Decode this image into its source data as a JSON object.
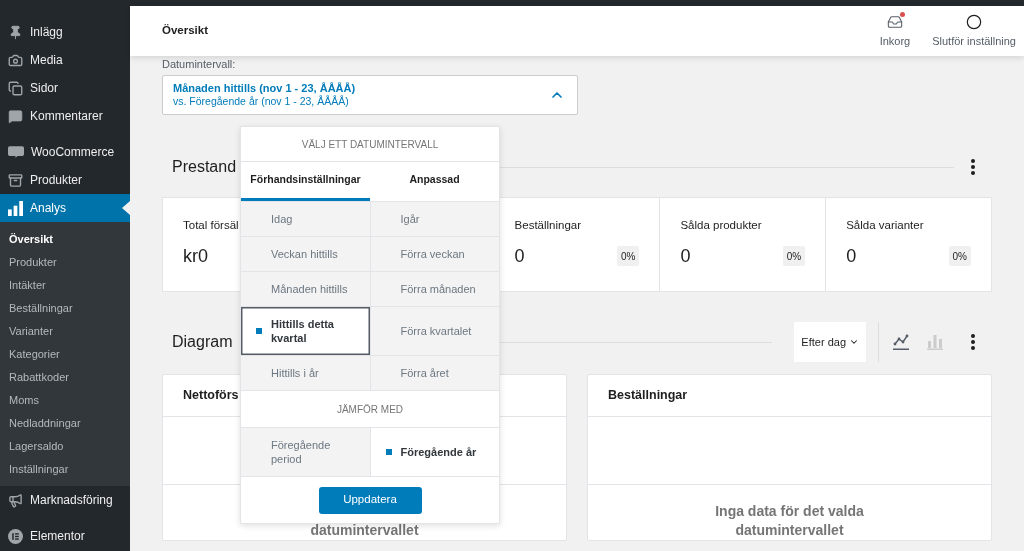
{
  "sidebar": {
    "groups": [
      {
        "items": [
          {
            "kind": "pin",
            "label": "Inlägg",
            "selected": false
          },
          {
            "kind": "media",
            "label": "Media",
            "selected": false
          },
          {
            "kind": "pages",
            "label": "Sidor",
            "selected": false
          },
          {
            "kind": "comments",
            "label": "Kommentarer",
            "selected": false
          }
        ]
      },
      {
        "items": [
          {
            "kind": "woocommerce",
            "label": "WooCommerce",
            "selected": false
          },
          {
            "kind": "products",
            "label": "Produkter",
            "selected": false
          },
          {
            "kind": "analytics",
            "label": "Analys",
            "selected": true,
            "children": [
              {
                "label": "Översikt",
                "selected": true
              },
              {
                "label": "Produkter",
                "selected": false
              },
              {
                "label": "Intäkter",
                "selected": false
              },
              {
                "label": "Beställningar",
                "selected": false
              },
              {
                "label": "Varianter",
                "selected": false
              },
              {
                "label": "Kategorier",
                "selected": false
              },
              {
                "label": "Rabattkoder",
                "selected": false
              },
              {
                "label": "Moms",
                "selected": false
              },
              {
                "label": "Nedladdningar",
                "selected": false
              },
              {
                "label": "Lagersaldo",
                "selected": false
              },
              {
                "label": "Inställningar",
                "selected": false
              }
            ]
          },
          {
            "kind": "marketing",
            "label": "Marknadsföring",
            "selected": false
          }
        ]
      },
      {
        "items": [
          {
            "kind": "elementor",
            "label": "Elementor",
            "selected": false
          }
        ]
      }
    ]
  },
  "header": {
    "title": "Översikt",
    "actions": [
      {
        "kind": "inbox",
        "label": "Inkorg",
        "unread": true
      },
      {
        "kind": "setup",
        "label": "Slutför inställning"
      }
    ]
  },
  "date_range": {
    "label": "Datumintervall:",
    "primary": "Månaden hittills (nov 1 - 23, ÅÅÅÅ)",
    "compare": "vs. Föregående år (nov 1 - 23, ÅÅÅÅ)",
    "expanded": true
  },
  "date_picker": {
    "title": "VÄLJ ETT DATUMINTERVALL",
    "tabs": [
      {
        "label": "Förhandsinställningar",
        "selected": true
      },
      {
        "label": "Anpassad",
        "selected": false
      }
    ],
    "presets": [
      {
        "label": "Idag",
        "selected": false
      },
      {
        "label": "Igår",
        "selected": false
      },
      {
        "label": "Veckan hittills",
        "selected": false
      },
      {
        "label": "Förra veckan",
        "selected": false
      },
      {
        "label": "Månaden hittills",
        "selected": false
      },
      {
        "label": "Förra månaden",
        "selected": false
      },
      {
        "label": "Hittills detta kvartal",
        "selected": true
      },
      {
        "label": "Förra kvartalet",
        "selected": false
      },
      {
        "label": "Hittills i år",
        "selected": false
      },
      {
        "label": "Förra året",
        "selected": false
      }
    ],
    "compare_title": "JÄMFÖR MED",
    "compare_options": [
      {
        "label": "Föregående period",
        "selected": false
      },
      {
        "label": "Föregående år",
        "selected": true
      }
    ],
    "button": "Uppdatera"
  },
  "performance": {
    "title": "Prestand",
    "cards": [
      {
        "label": "Total försäl",
        "value": "kr0"
      },
      {
        "label": "Beställningar",
        "value": "0",
        "change": "0%"
      },
      {
        "label": "Sålda produkter",
        "value": "0",
        "change": "0%"
      },
      {
        "label": "Sålda varianter",
        "value": "0",
        "change": "0%"
      }
    ]
  },
  "diagram": {
    "title": "Diagram",
    "interval": "Efter dag",
    "chart_types": [
      {
        "kind": "line",
        "selected": true
      },
      {
        "kind": "bar",
        "selected": false
      }
    ],
    "charts": [
      {
        "title": "Nettoförs",
        "empty_message": "datumintervallet"
      },
      {
        "title": "Beställningar",
        "empty_message": "Inga data för det valda datumintervallet"
      }
    ]
  }
}
